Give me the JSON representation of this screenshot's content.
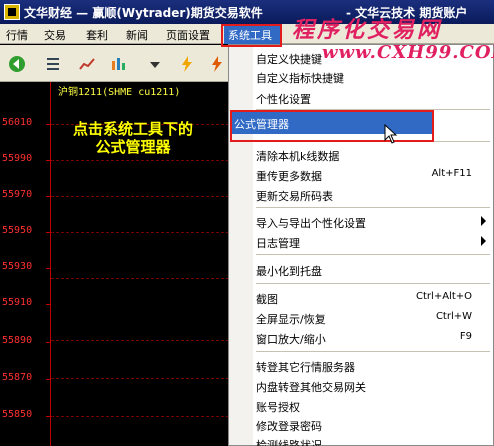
{
  "window": {
    "title": "文华财经 — 赢顺(Wytrader)期货交易软件",
    "title_right": "- 文华云技术 期货账户"
  },
  "watermark": {
    "line1": "程序化交易网",
    "line2": "www.CXH99.COM"
  },
  "menubar": {
    "items": [
      "行情",
      "交易",
      "套利",
      "新闻",
      "页面设置",
      "系统工具"
    ]
  },
  "toolbar": {
    "icons": [
      "back-icon",
      "list-icon",
      "trend-chart-icon",
      "multi-chart-icon",
      "dropdown-arrow-icon",
      "lightning-icon",
      "lightning-icon"
    ]
  },
  "chart": {
    "header": "沪铜1211(SHME cu1211)",
    "price_labels": [
      "56010",
      "55990",
      "55970",
      "55950",
      "55930",
      "55910",
      "55890",
      "55870",
      "55850"
    ],
    "annotation_line1": "点击系统工具下的",
    "annotation_line2": "公式管理器",
    "axis_color": "#c00000",
    "label_color": "#ff3030"
  },
  "dropdown": {
    "items": [
      {
        "label": "自定义快捷键",
        "shortcut": "",
        "submenu": false
      },
      {
        "label": "自定义指标快捷键",
        "shortcut": "",
        "submenu": false
      },
      {
        "label": "个性化设置",
        "shortcut": "",
        "submenu": false
      },
      {
        "label": "公式管理器",
        "shortcut": "",
        "submenu": false,
        "highlighted": true
      },
      {
        "label": "清除本机k线数据",
        "shortcut": "",
        "submenu": false
      },
      {
        "label": "重传更多数据",
        "shortcut": "Alt+F11",
        "submenu": false
      },
      {
        "label": "更新交易所码表",
        "shortcut": "",
        "submenu": false
      },
      {
        "label": "导入与导出个性化设置",
        "shortcut": "",
        "submenu": true
      },
      {
        "label": "日志管理",
        "shortcut": "",
        "submenu": true
      },
      {
        "label": "最小化到托盘",
        "shortcut": "",
        "submenu": false
      },
      {
        "label": "截图",
        "shortcut": "Ctrl+Alt+O",
        "submenu": false
      },
      {
        "label": "全屏显示/恢复",
        "shortcut": "Ctrl+W",
        "submenu": false
      },
      {
        "label": "窗口放大/缩小",
        "shortcut": "F9",
        "submenu": false
      },
      {
        "label": "转登其它行情服务器",
        "shortcut": "",
        "submenu": false
      },
      {
        "label": "内盘转登其他交易网关",
        "shortcut": "",
        "submenu": false
      },
      {
        "label": "账号授权",
        "shortcut": "",
        "submenu": false
      },
      {
        "label": "修改登录密码",
        "shortcut": "",
        "submenu": false
      },
      {
        "label": "检测线路状况",
        "shortcut": "",
        "submenu": false
      }
    ]
  },
  "colors": {
    "highlight": "#316ac5",
    "callout_border": "#e41b1b",
    "annotation": "#ffff00"
  }
}
